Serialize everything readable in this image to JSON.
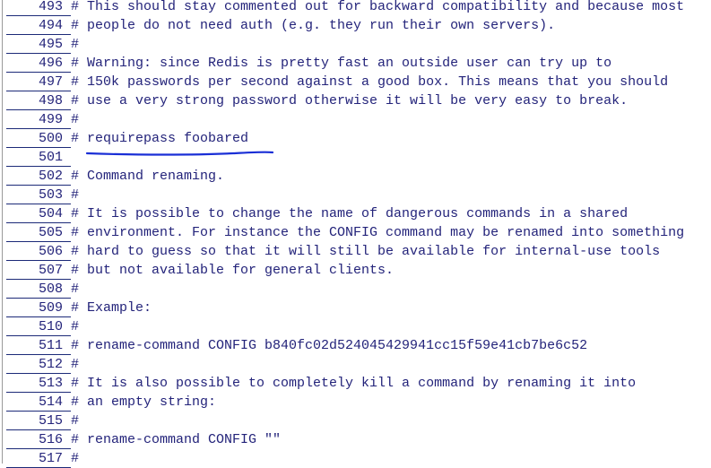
{
  "editor": {
    "lines": [
      {
        "number": "493",
        "text": "# This should stay commented out for backward compatibility and because most"
      },
      {
        "number": "494",
        "text": "# people do not need auth (e.g. they run their own servers)."
      },
      {
        "number": "495",
        "text": "#"
      },
      {
        "number": "496",
        "text": "# Warning: since Redis is pretty fast an outside user can try up to"
      },
      {
        "number": "497",
        "text": "# 150k passwords per second against a good box. This means that you should"
      },
      {
        "number": "498",
        "text": "# use a very strong password otherwise it will be very easy to break."
      },
      {
        "number": "499",
        "text": "#"
      },
      {
        "number": "500",
        "text": "# requirepass foobared"
      },
      {
        "number": "501",
        "text": ""
      },
      {
        "number": "502",
        "text": "# Command renaming."
      },
      {
        "number": "503",
        "text": "#"
      },
      {
        "number": "504",
        "text": "# It is possible to change the name of dangerous commands in a shared"
      },
      {
        "number": "505",
        "text": "# environment. For instance the CONFIG command may be renamed into something"
      },
      {
        "number": "506",
        "text": "# hard to guess so that it will still be available for internal-use tools"
      },
      {
        "number": "507",
        "text": "# but not available for general clients."
      },
      {
        "number": "508",
        "text": "#"
      },
      {
        "number": "509",
        "text": "# Example:"
      },
      {
        "number": "510",
        "text": "#"
      },
      {
        "number": "511",
        "text": "# rename-command CONFIG b840fc02d524045429941cc15f59e41cb7be6c52"
      },
      {
        "number": "512",
        "text": "#"
      },
      {
        "number": "513",
        "text": "# It is also possible to completely kill a command by renaming it into"
      },
      {
        "number": "514",
        "text": "# an empty string:"
      },
      {
        "number": "515",
        "text": "#"
      },
      {
        "number": "516",
        "text": "# rename-command CONFIG \"\""
      },
      {
        "number": "517",
        "text": "#"
      }
    ]
  },
  "annotation": {
    "underlined_line": "500",
    "color": "#1a2fd6"
  },
  "colors": {
    "text": "#23237a",
    "rule": "#1c2a78"
  }
}
